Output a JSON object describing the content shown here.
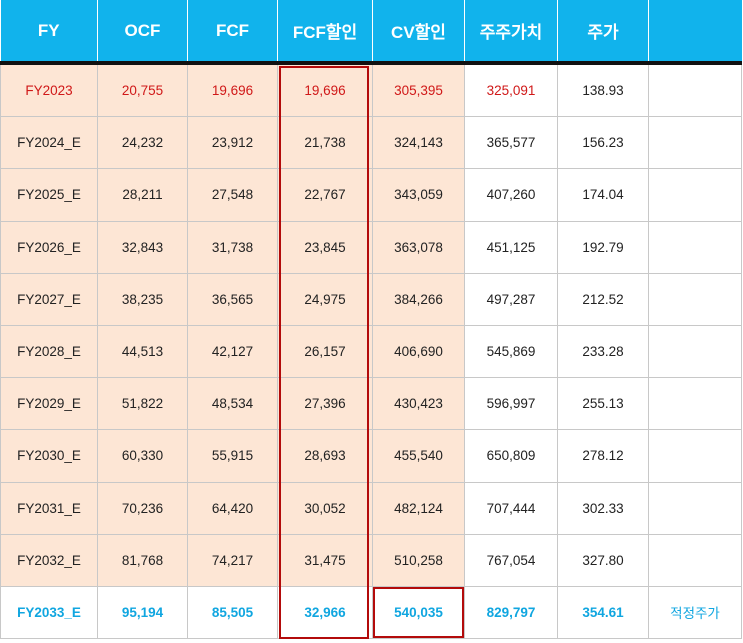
{
  "table": {
    "headers": [
      "FY",
      "OCF",
      "FCF",
      "FCF할인",
      "CV할인",
      "주주가치",
      "주가",
      ""
    ],
    "rows": [
      {
        "fy": "FY2023",
        "ocf": "20,755",
        "fcf": "19,696",
        "fcf_disc": "19,696",
        "cv_disc": "305,395",
        "equity": "325,091",
        "price": "138.93",
        "note": ""
      },
      {
        "fy": "FY2024_E",
        "ocf": "24,232",
        "fcf": "23,912",
        "fcf_disc": "21,738",
        "cv_disc": "324,143",
        "equity": "365,577",
        "price": "156.23",
        "note": ""
      },
      {
        "fy": "FY2025_E",
        "ocf": "28,211",
        "fcf": "27,548",
        "fcf_disc": "22,767",
        "cv_disc": "343,059",
        "equity": "407,260",
        "price": "174.04",
        "note": ""
      },
      {
        "fy": "FY2026_E",
        "ocf": "32,843",
        "fcf": "31,738",
        "fcf_disc": "23,845",
        "cv_disc": "363,078",
        "equity": "451,125",
        "price": "192.79",
        "note": ""
      },
      {
        "fy": "FY2027_E",
        "ocf": "38,235",
        "fcf": "36,565",
        "fcf_disc": "24,975",
        "cv_disc": "384,266",
        "equity": "497,287",
        "price": "212.52",
        "note": ""
      },
      {
        "fy": "FY2028_E",
        "ocf": "44,513",
        "fcf": "42,127",
        "fcf_disc": "26,157",
        "cv_disc": "406,690",
        "equity": "545,869",
        "price": "233.28",
        "note": ""
      },
      {
        "fy": "FY2029_E",
        "ocf": "51,822",
        "fcf": "48,534",
        "fcf_disc": "27,396",
        "cv_disc": "430,423",
        "equity": "596,997",
        "price": "255.13",
        "note": ""
      },
      {
        "fy": "FY2030_E",
        "ocf": "60,330",
        "fcf": "55,915",
        "fcf_disc": "28,693",
        "cv_disc": "455,540",
        "equity": "650,809",
        "price": "278.12",
        "note": ""
      },
      {
        "fy": "FY2031_E",
        "ocf": "70,236",
        "fcf": "64,420",
        "fcf_disc": "30,052",
        "cv_disc": "482,124",
        "equity": "707,444",
        "price": "302.33",
        "note": ""
      },
      {
        "fy": "FY2032_E",
        "ocf": "81,768",
        "fcf": "74,217",
        "fcf_disc": "31,475",
        "cv_disc": "510,258",
        "equity": "767,054",
        "price": "327.80",
        "note": ""
      },
      {
        "fy": "FY2033_E",
        "ocf": "95,194",
        "fcf": "85,505",
        "fcf_disc": "32,966",
        "cv_disc": "540,035",
        "equity": "829,797",
        "price": "354.61",
        "note": "적정주가"
      }
    ]
  },
  "colors": {
    "header_bg": "#11b3ec",
    "shade_bg": "#fde6d5",
    "first_row_text": "#d01818",
    "last_row_text": "#10a6e0",
    "highlight_border": "#b30b0b"
  }
}
